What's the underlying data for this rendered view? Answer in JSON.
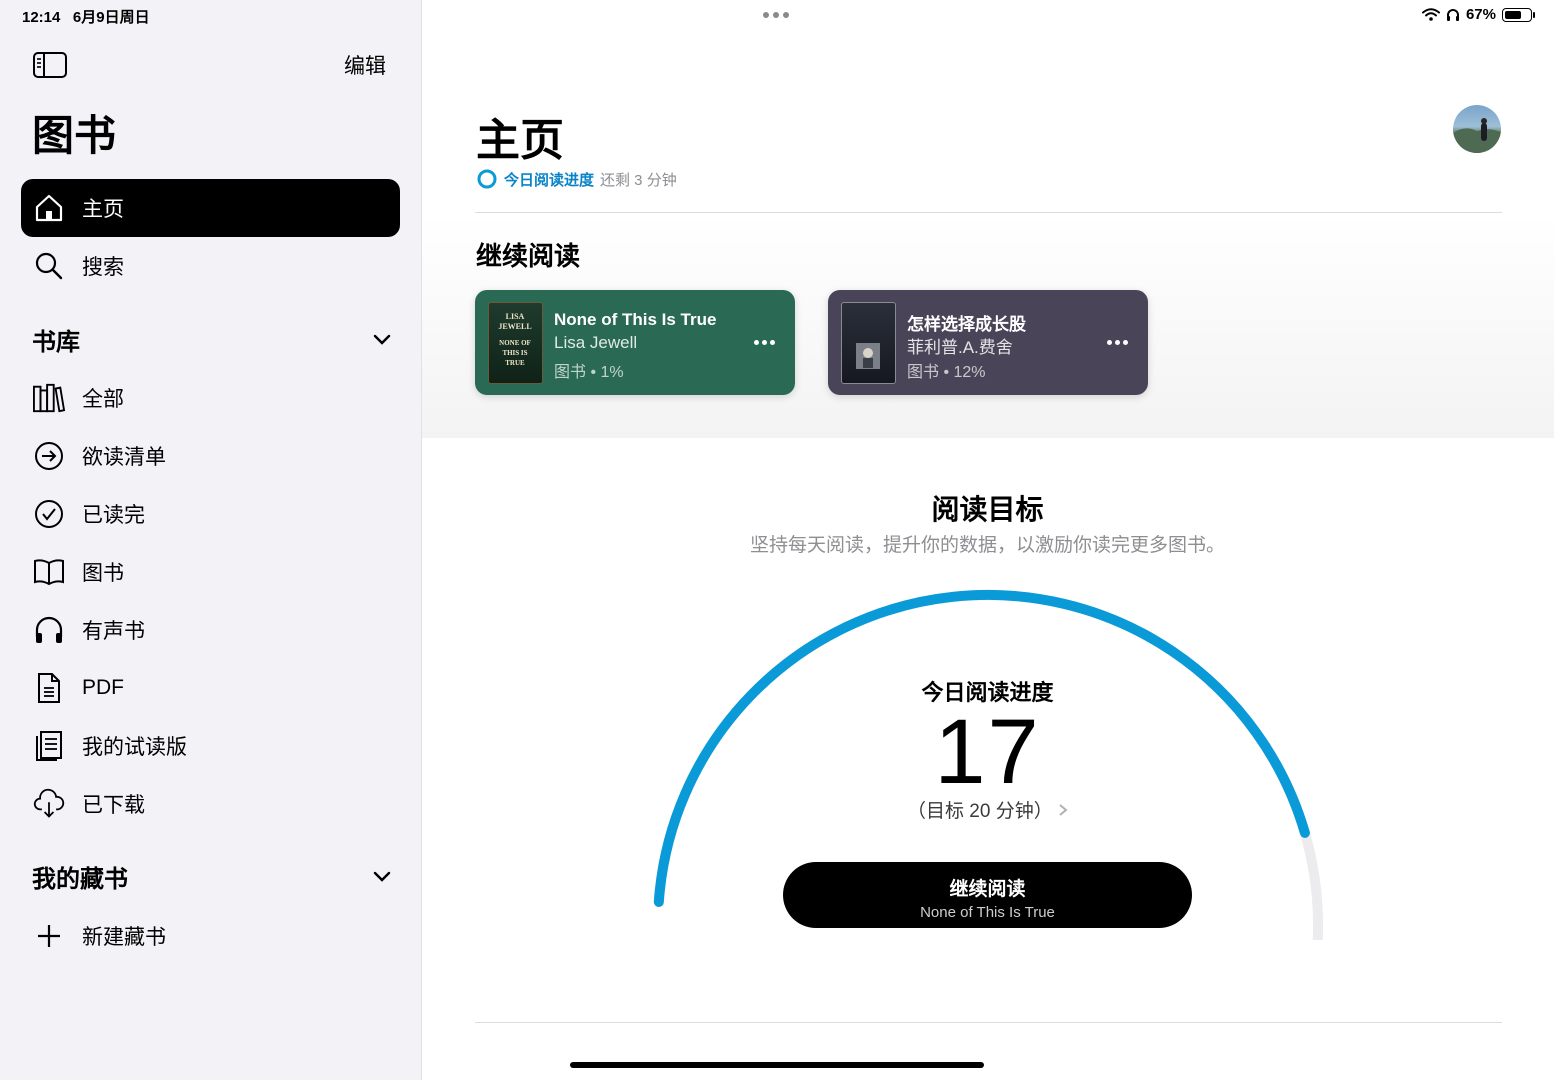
{
  "status": {
    "time": "12:14",
    "date": "6月9日周日",
    "battery": "67%",
    "battery_level": 0.67
  },
  "sidebar": {
    "edit_label": "编辑",
    "title": "图书",
    "top_items": [
      {
        "label": "主页",
        "icon": "house-icon",
        "active": true
      },
      {
        "label": "搜索",
        "icon": "search-icon",
        "active": false
      }
    ],
    "library_header": "书库",
    "library_items": [
      {
        "label": "全部",
        "icon": "books-icon"
      },
      {
        "label": "欲读清单",
        "icon": "arrow-circle-icon"
      },
      {
        "label": "已读完",
        "icon": "checkmark-circle-icon"
      },
      {
        "label": "图书",
        "icon": "open-book-icon"
      },
      {
        "label": "有声书",
        "icon": "headphones-icon"
      },
      {
        "label": "PDF",
        "icon": "document-icon"
      },
      {
        "label": "我的试读版",
        "icon": "sample-icon"
      },
      {
        "label": "已下载",
        "icon": "download-cloud-icon"
      }
    ],
    "collections_header": "我的藏书",
    "new_collection_label": "新建藏书"
  },
  "main": {
    "title": "主页",
    "goal_link": "今日阅读进度",
    "goal_remaining": "还剩 3 分钟",
    "continue_title": "继续阅读",
    "books": [
      {
        "title": "None of This Is True",
        "author": "Lisa Jewell",
        "meta": "图书 • 1%",
        "color": "#2a6a55"
      },
      {
        "title": "怎样选择成长股",
        "author": "菲利普.A.费舍",
        "meta": "图书 • 12%",
        "color": "#4a4458"
      }
    ],
    "reading_goal": {
      "title": "阅读目标",
      "subtitle": "坚持每天阅读，提升你的数据，以激励你读完更多图书。",
      "label": "今日阅读进度",
      "value": "17",
      "target": "（目标 20 分钟）",
      "progress": 0.85,
      "button_title": "继续阅读",
      "button_subtitle": "None of This Is True"
    }
  },
  "colors": {
    "accent": "#0a9ad8",
    "track": "#ececee"
  }
}
